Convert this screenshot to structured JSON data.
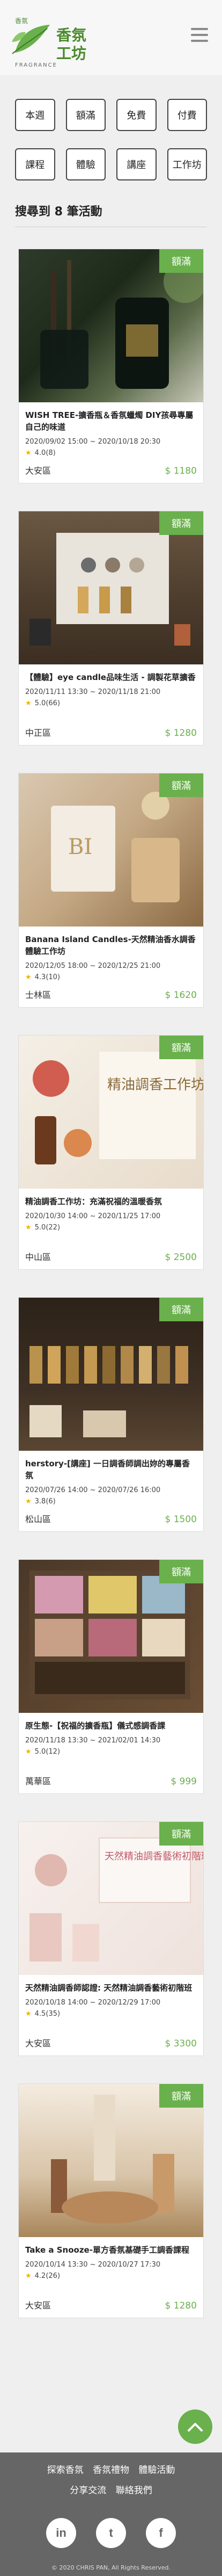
{
  "brand": {
    "small": "香氛",
    "name_line1": "香氛",
    "name_line2": "工坊",
    "english": "FRAGRANCE"
  },
  "filters": [
    "本週",
    "額滿",
    "免費",
    "付費",
    "課程",
    "體驗",
    "講座",
    "工作坊"
  ],
  "result_title": "搜尋到 8 筆活動",
  "cards": [
    {
      "badge": "額滿",
      "title": "WISH TREE-擴香瓶＆香氛蠟燭 DIY孩尋專屬自己的味道",
      "date": "2020/09/02 15:00 ~ 2020/10/18 20:30",
      "rating": "4.0(8)",
      "location": "大安區",
      "price": "$ 1180"
    },
    {
      "badge": "額滿",
      "title": "【體驗】eye candle品味生活 - 調製花草擴香",
      "date": "2020/11/11 13:30 ~ 2020/11/18 21:00",
      "rating": "5.0(66)",
      "location": "中正區",
      "price": "$ 1280"
    },
    {
      "badge": "額滿",
      "title": "Banana Island Candles-天然精油香水調香體驗工作坊",
      "date": "2020/12/05 18:00 ~ 2020/12/25 21:00",
      "rating": "4.3(10)",
      "location": "士林區",
      "price": "$ 1620"
    },
    {
      "badge": "額滿",
      "title": "精油調香工作坊：充滿祝福的溫暖香氛",
      "date": "2020/10/30 14:00 ~ 2020/11/25 17:00",
      "rating": "5.0(22)",
      "location": "中山區",
      "price": "$ 2500"
    },
    {
      "badge": "額滿",
      "title": "herstory-[講座] 一日調香師調出妳的專屬香氛",
      "date": "2020/07/26 14:00 ~ 2020/07/26 16:00",
      "rating": "3.8(6)",
      "location": "松山區",
      "price": "$ 1500"
    },
    {
      "badge": "額滿",
      "title": "原生態-【祝福的擴香瓶】儀式感調香課",
      "date": "2020/11/18 13:30 ~ 2021/02/01 14:30",
      "rating": "5.0(12)",
      "location": "萬華區",
      "price": "$ 999"
    },
    {
      "badge": "額滿",
      "title": "天然精油調香師認證: 天然精油調香藝術初階班",
      "date": "2020/10/18 14:00 ~ 2020/12/29 17:00",
      "rating": "4.5(35)",
      "location": "大安區",
      "price": "$ 3300"
    },
    {
      "badge": "額滿",
      "title": "Take a Snooze-單方香氛基礎手工調香課程",
      "date": "2020/10/14 13:30 ~ 2020/10/27 17:30",
      "rating": "4.2(26)",
      "location": "大安區",
      "price": "$ 1280"
    }
  ],
  "images": [
    {
      "label": "",
      "sub": ""
    },
    {
      "label": "",
      "sub": ""
    },
    {
      "label": "BI",
      "sub": ""
    },
    {
      "label": "精油調香工作坊",
      "sub": ""
    },
    {
      "label": "",
      "sub": ""
    },
    {
      "label": "",
      "sub": ""
    },
    {
      "label": "天然精油調香藝術初階班",
      "sub": ""
    },
    {
      "label": "",
      "sub": ""
    }
  ],
  "footer": {
    "links_row1": [
      "探索香氛",
      "香氛禮物",
      "體驗活動"
    ],
    "links_row2": [
      "分享交流",
      "聯絡我們"
    ],
    "social": [
      "in",
      "t",
      "f"
    ],
    "copyright": "© 2020 CHRIS PAN, All Rights Reserved."
  },
  "colors": {
    "accent": "#6ab04c",
    "footer": "#666666",
    "star": "#f0b400"
  },
  "icons": {
    "menu": "hamburger-icon",
    "scroll_top": "chevron-up-icon",
    "rating": "star-icon"
  }
}
